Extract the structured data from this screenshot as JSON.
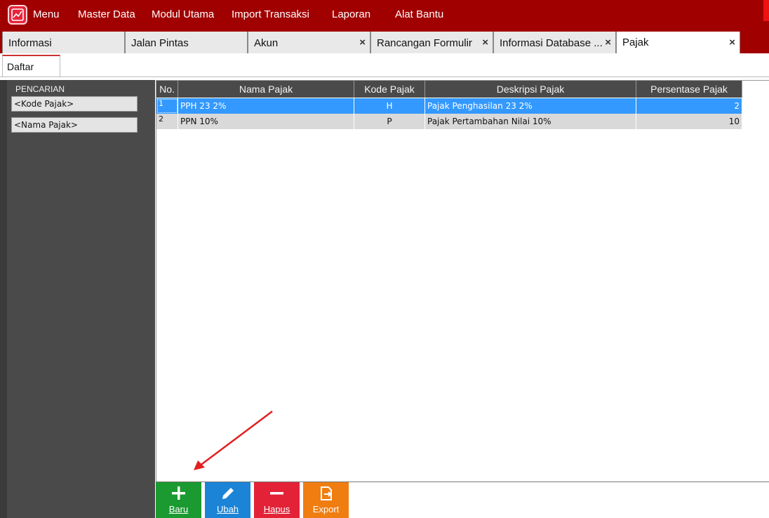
{
  "menu": {
    "items": [
      "Menu",
      "Master Data",
      "Modul Utama",
      "Import Transaksi",
      "Laporan",
      "Alat Bantu"
    ]
  },
  "tabs": [
    {
      "label": "Informasi",
      "closable": false
    },
    {
      "label": "Jalan Pintas",
      "closable": false
    },
    {
      "label": "Akun",
      "closable": true
    },
    {
      "label": "Rancangan Formulir",
      "closable": true
    },
    {
      "label": "Informasi Database ...",
      "closable": true
    },
    {
      "label": "Pajak",
      "closable": true,
      "active": true
    }
  ],
  "subtab": {
    "label": "Daftar"
  },
  "search_panel": {
    "title": "PENCARIAN",
    "fields": [
      "<Kode Pajak>",
      "<Nama Pajak>"
    ]
  },
  "grid": {
    "columns": [
      "No.",
      "Nama Pajak",
      "Kode Pajak",
      "Deskripsi Pajak",
      "Persentase Pajak"
    ],
    "rows": [
      {
        "no": "1",
        "nama": "PPH 23 2%",
        "kode": "H",
        "deskripsi": "Pajak Penghasilan 23 2%",
        "persen": "2",
        "selected": true
      },
      {
        "no": "2",
        "nama": "PPN 10%",
        "kode": "P",
        "deskripsi": "Pajak Pertambahan Nilai 10%",
        "persen": "10",
        "selected": false
      }
    ]
  },
  "toolbar": {
    "baru": "Baru",
    "ubah": "Ubah",
    "hapus": "Hapus",
    "export": "Export"
  },
  "colors": {
    "menubar": "#a10000",
    "selected_row": "#3399ff",
    "btn_baru": "#1a9a30",
    "btn_ubah": "#1b84d6",
    "btn_hapus": "#e32238",
    "btn_export": "#f07d10",
    "annotation_arrow": "#e02020"
  }
}
